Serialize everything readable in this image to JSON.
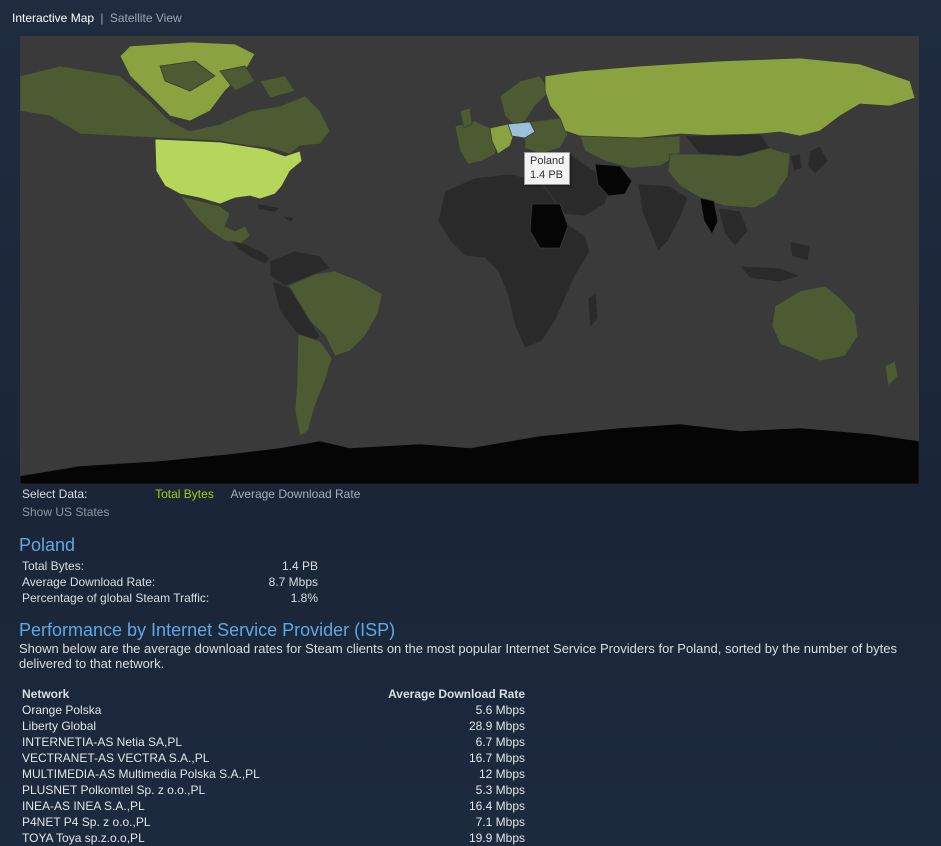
{
  "tabs": {
    "active": "Interactive Map",
    "separator": "|",
    "inactive": "Satellite View"
  },
  "map": {
    "tooltip": {
      "country": "Poland",
      "value": "1.4 PB"
    },
    "colors": {
      "ocean": "#3a3a3a",
      "none": "#2a2a2a",
      "low": "#4d5a32",
      "medium": "#8aa23f",
      "high": "#b5d65a",
      "selected": "#9cc0d8",
      "black": "#050505"
    }
  },
  "select_data": {
    "label": "Select Data:",
    "options": [
      "Total Bytes",
      "Average Download Rate"
    ],
    "selected": "Total Bytes",
    "us_states": "Show US States"
  },
  "country": {
    "name": "Poland",
    "stats": [
      {
        "label": "Total Bytes:",
        "value": "1.4 PB"
      },
      {
        "label": "Average Download Rate:",
        "value": "8.7 Mbps"
      },
      {
        "label": "Percentage of global Steam Traffic:",
        "value": "1.8%"
      }
    ]
  },
  "isp": {
    "title": "Performance by Internet Service Provider (ISP)",
    "description": "Shown below are the average download rates for Steam clients on the most popular Internet Service Providers for Poland, sorted by the number of bytes delivered to that network.",
    "headers": {
      "network": "Network",
      "rate": "Average Download Rate"
    },
    "rows": [
      {
        "network": "Orange Polska",
        "rate": "5.6 Mbps"
      },
      {
        "network": "Liberty Global",
        "rate": "28.9 Mbps"
      },
      {
        "network": "INTERNETIA-AS Netia SA,PL",
        "rate": "6.7 Mbps"
      },
      {
        "network": "VECTRANET-AS VECTRA S.A.,PL",
        "rate": "16.7 Mbps"
      },
      {
        "network": "MULTIMEDIA-AS Multimedia Polska S.A.,PL",
        "rate": "12 Mbps"
      },
      {
        "network": "PLUSNET Polkomtel Sp. z o.o.,PL",
        "rate": "5.3 Mbps"
      },
      {
        "network": "INEA-AS INEA S.A.,PL",
        "rate": "16.4 Mbps"
      },
      {
        "network": "P4NET P4 Sp. z o.o.,PL",
        "rate": "7.1 Mbps"
      },
      {
        "network": "TOYA Toya sp.z.o.o,PL",
        "rate": "19.9 Mbps"
      }
    ]
  }
}
